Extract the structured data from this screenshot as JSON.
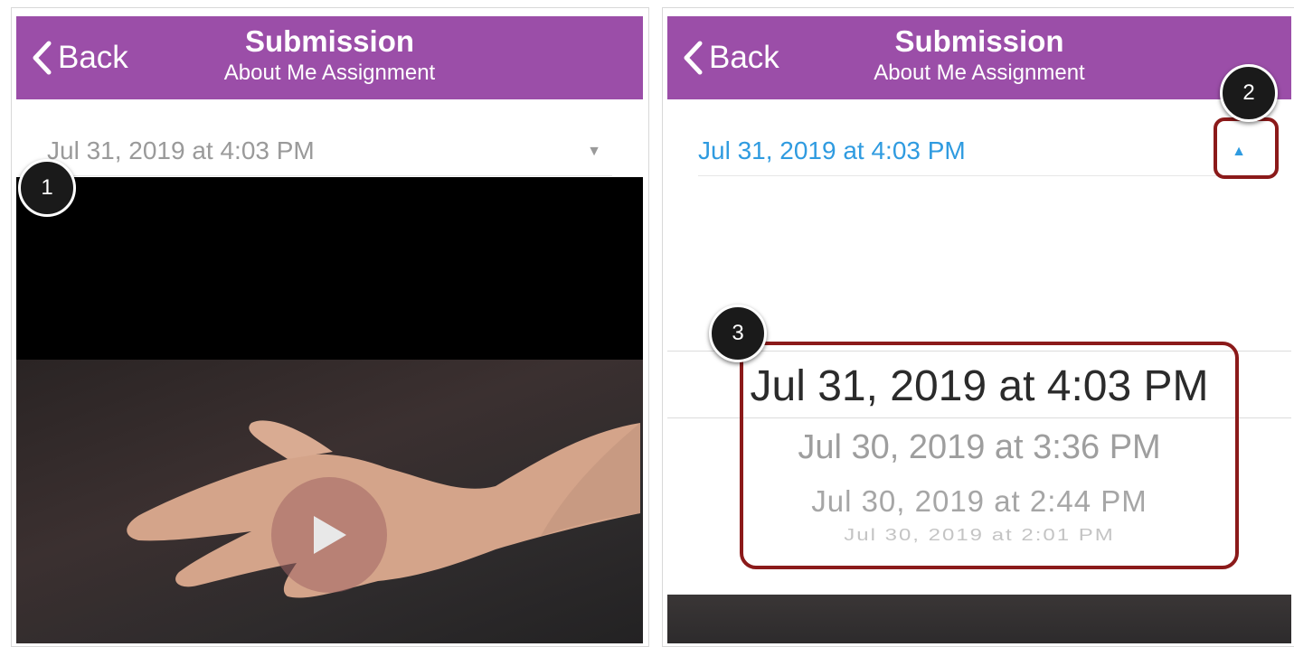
{
  "left": {
    "nav": {
      "back_label": "Back",
      "title": "Submission",
      "subtitle": "About Me Assignment"
    },
    "picker": {
      "value": "Jul 31, 2019 at 4:03 PM",
      "caret": "▼"
    }
  },
  "right": {
    "nav": {
      "back_label": "Back",
      "title": "Submission",
      "subtitle": "About Me Assignment"
    },
    "picker": {
      "value": "Jul 31, 2019 at 4:03 PM",
      "caret": "▲"
    },
    "wheel_options": [
      "Jul 31, 2019 at 4:03 PM",
      "Jul 30, 2019 at 3:36 PM",
      "Jul 30, 2019 at 2:44 PM",
      "Jul 30, 2019 at 2:01 PM"
    ]
  },
  "badges": [
    "1",
    "2",
    "3"
  ],
  "colors": {
    "navbar": "#9b4ea8",
    "accent": "#2f9be0",
    "highlight": "#8b1a1a"
  },
  "icons": {
    "back": "chevron-left-icon",
    "caret_down": "caret-down-icon",
    "caret_up": "caret-up-icon",
    "play": "play-icon"
  }
}
